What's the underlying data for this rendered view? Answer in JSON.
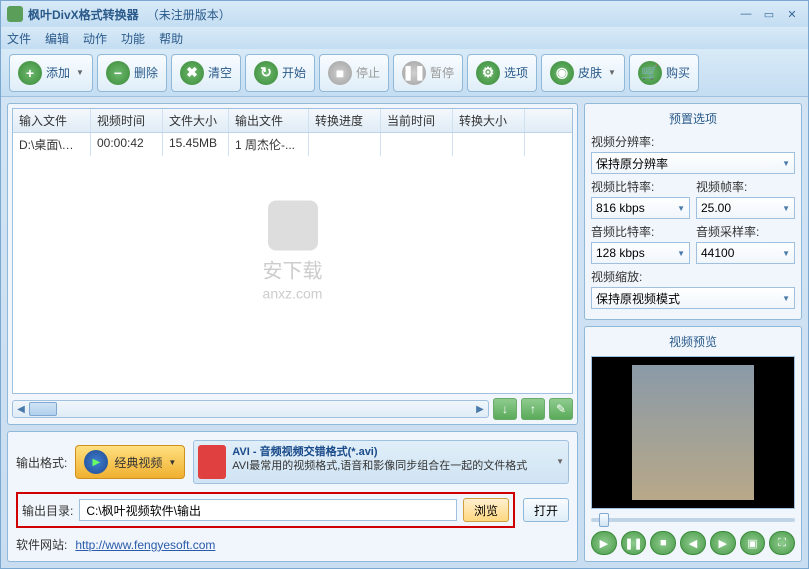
{
  "title": {
    "app": "枫叶DivX格式转换器",
    "suffix": "（未注册版本）"
  },
  "menu": [
    "文件",
    "编辑",
    "动作",
    "功能",
    "帮助"
  ],
  "toolbar": {
    "add": "添加",
    "del": "删除",
    "clear": "清空",
    "start": "开始",
    "stop": "停止",
    "pause": "暂停",
    "opt": "选项",
    "skin": "皮肤",
    "buy": "购买"
  },
  "table": {
    "cols": [
      "输入文件",
      "视频时间",
      "文件大小",
      "输出文件",
      "转换进度",
      "当前时间",
      "转换大小"
    ],
    "rows": [
      {
        "c0": "D:\\桌面\\说明...",
        "c1": "00:00:42",
        "c2": "15.45MB",
        "c3": "1 周杰伦-...",
        "c4": "",
        "c5": "",
        "c6": ""
      }
    ]
  },
  "watermark": {
    "t1": "安下载",
    "t2": "anxz.com"
  },
  "output": {
    "format_label": "输出格式:",
    "format_btn": "经典视频",
    "format_title": "AVI - 音频视频交错格式(*.avi)",
    "format_desc": "AVI最常用的视频格式,语音和影像同步组合在一起的文件格式",
    "dir_label": "输出目录:",
    "dir_value": "C:\\枫叶视频软件\\输出",
    "browse": "浏览",
    "open": "打开",
    "site_label": "软件网站:",
    "site_url": "http://www.fengyesoft.com"
  },
  "settings": {
    "title": "预置选项",
    "res_label": "视频分辨率:",
    "res_value": "保持原分辨率",
    "vbr_label": "视频比特率:",
    "vbr_value": "816 kbps",
    "fps_label": "视频帧率:",
    "fps_value": "25.00",
    "abr_label": "音频比特率:",
    "abr_value": "128 kbps",
    "asr_label": "音频采样率:",
    "asr_value": "44100",
    "zoom_label": "视频缩放:",
    "zoom_value": "保持原视频模式"
  },
  "preview": {
    "title": "视频预览"
  }
}
